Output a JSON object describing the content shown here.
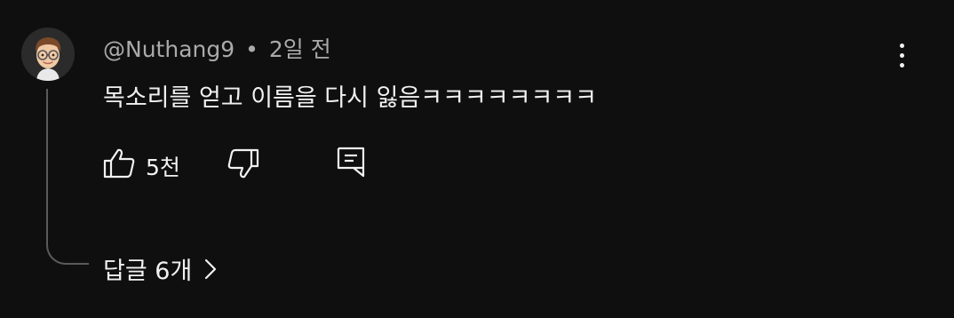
{
  "comment": {
    "author": "@Nuthang9",
    "separator": "•",
    "time": "2일 전",
    "text": "목소리를 얻고 이름을 다시 잃음ㅋㅋㅋㅋㅋㅋㅋㅋ",
    "like_count": "5천",
    "replies_label": "답글 6개"
  },
  "icons": {
    "avatar": "memoji-avatar",
    "menu": "more-vertical-icon",
    "like": "thumbs-up-icon",
    "dislike": "thumbs-down-icon",
    "reply": "reply-comment-icon",
    "replies_chevron": "chevron-right-icon"
  },
  "colors": {
    "background": "#0f0f0f",
    "text_primary": "#f1f1f1",
    "text_secondary": "#aaaaaa",
    "thread_line": "#5a5a5a"
  }
}
